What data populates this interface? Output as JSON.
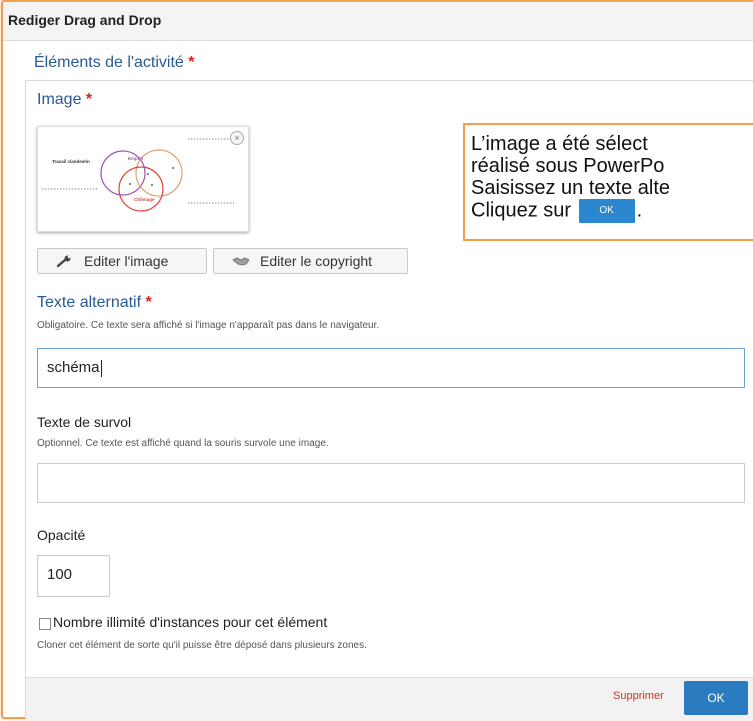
{
  "dialog": {
    "title": "Rediger Drag and Drop"
  },
  "section": {
    "title": "Éléments de l'activité",
    "required_mark": "*"
  },
  "image": {
    "label": "Image",
    "required_mark": "*",
    "thumbnail": {
      "close_glyph": "×",
      "labels": {
        "left": "Travail clandestin",
        "top": "Emploi",
        "bottom": "Chômage"
      },
      "colors": {
        "purple": "#9b59b6",
        "orange": "#e0a070",
        "red": "#e0443c"
      }
    },
    "edit_image_label": "Editer l'image",
    "edit_copyright_label": "Editer le copyright",
    "edit_image_icon": "wrench-icon",
    "edit_copyright_icon": "handshake-icon"
  },
  "alt_text": {
    "label": "Texte alternatif",
    "required_mark": "*",
    "help": "Obligatoire. Ce texte sera affiché si l'image n'apparaît pas dans le navigateur.",
    "value": "schéma"
  },
  "hover_text": {
    "label": "Texte de survol",
    "help": "Optionnel. Ce texte est affiché quand la souris survole une image.",
    "value": ""
  },
  "opacity": {
    "label": "Opacité",
    "value": "100"
  },
  "unlimited": {
    "label": "Nombre illimité d'instances pour cet élément",
    "help": "Cloner cet élément de sorte qu'il puisse être déposé dans plusieurs zones.",
    "checked": false
  },
  "footer": {
    "delete_label": "Supprimer",
    "ok_label": "OK"
  },
  "callout": {
    "line1": "L’image a été sélect",
    "line2": "réalisé sous PowerPo",
    "line3": "Saisissez un texte alte",
    "line4_prefix": "Cliquez sur",
    "ok_label": "OK",
    "line4_suffix": "."
  },
  "colors": {
    "accent": "#2a7bc0",
    "title_blue": "#2a5a94",
    "required": "#d9261c",
    "callout_border": "#f0a050"
  }
}
